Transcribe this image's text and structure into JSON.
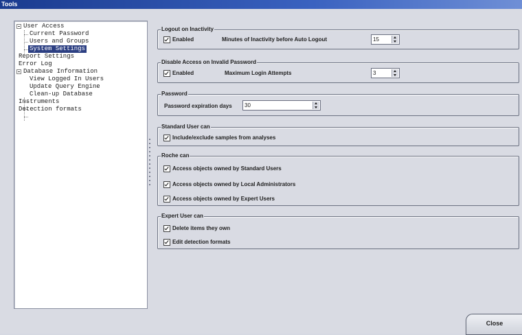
{
  "window": {
    "title": "Tools"
  },
  "tree": {
    "items": [
      {
        "label": "User Access",
        "expandable": true
      },
      {
        "label": "Current Password"
      },
      {
        "label": "Users and Groups"
      },
      {
        "label": "System Settings",
        "selected": true
      },
      {
        "label": "Report Settings"
      },
      {
        "label": "Error Log"
      },
      {
        "label": "Database Information",
        "expandable": true
      },
      {
        "label": "View Logged In Users"
      },
      {
        "label": "Update Query Engine"
      },
      {
        "label": "Clean-up Database"
      },
      {
        "label": "Instruments"
      },
      {
        "label": "Detection formats"
      }
    ]
  },
  "logout": {
    "legend": "Logout on Inactivity",
    "enabled_label": "Enabled",
    "enabled_checked": true,
    "minutes_label": "Minutes of Inactivity before Auto Logout",
    "minutes_value": "15"
  },
  "disable_access": {
    "legend": "Disable Access on Invalid Password",
    "enabled_label": "Enabled",
    "enabled_checked": true,
    "attempts_label": "Maximum Login Attempts",
    "attempts_value": "3"
  },
  "password": {
    "legend": "Password",
    "expiration_label": "Password expiration days",
    "expiration_value": "30"
  },
  "standard_user": {
    "legend": "Standard User can",
    "options": [
      {
        "label": "Include/exclude samples from analyses",
        "checked": true
      }
    ]
  },
  "roche": {
    "legend": "Roche can",
    "options": [
      {
        "label": "Access objects owned by Standard Users",
        "checked": true
      },
      {
        "label": "Access objects owned by Local Administrators",
        "checked": true
      },
      {
        "label": "Access objects owned by Expert Users",
        "checked": true
      }
    ]
  },
  "expert_user": {
    "legend": "Expert User can",
    "options": [
      {
        "label": "Delete items they own",
        "checked": true
      },
      {
        "label": "Edit detection formats",
        "checked": true
      }
    ]
  },
  "footer": {
    "close_label": "Close"
  }
}
